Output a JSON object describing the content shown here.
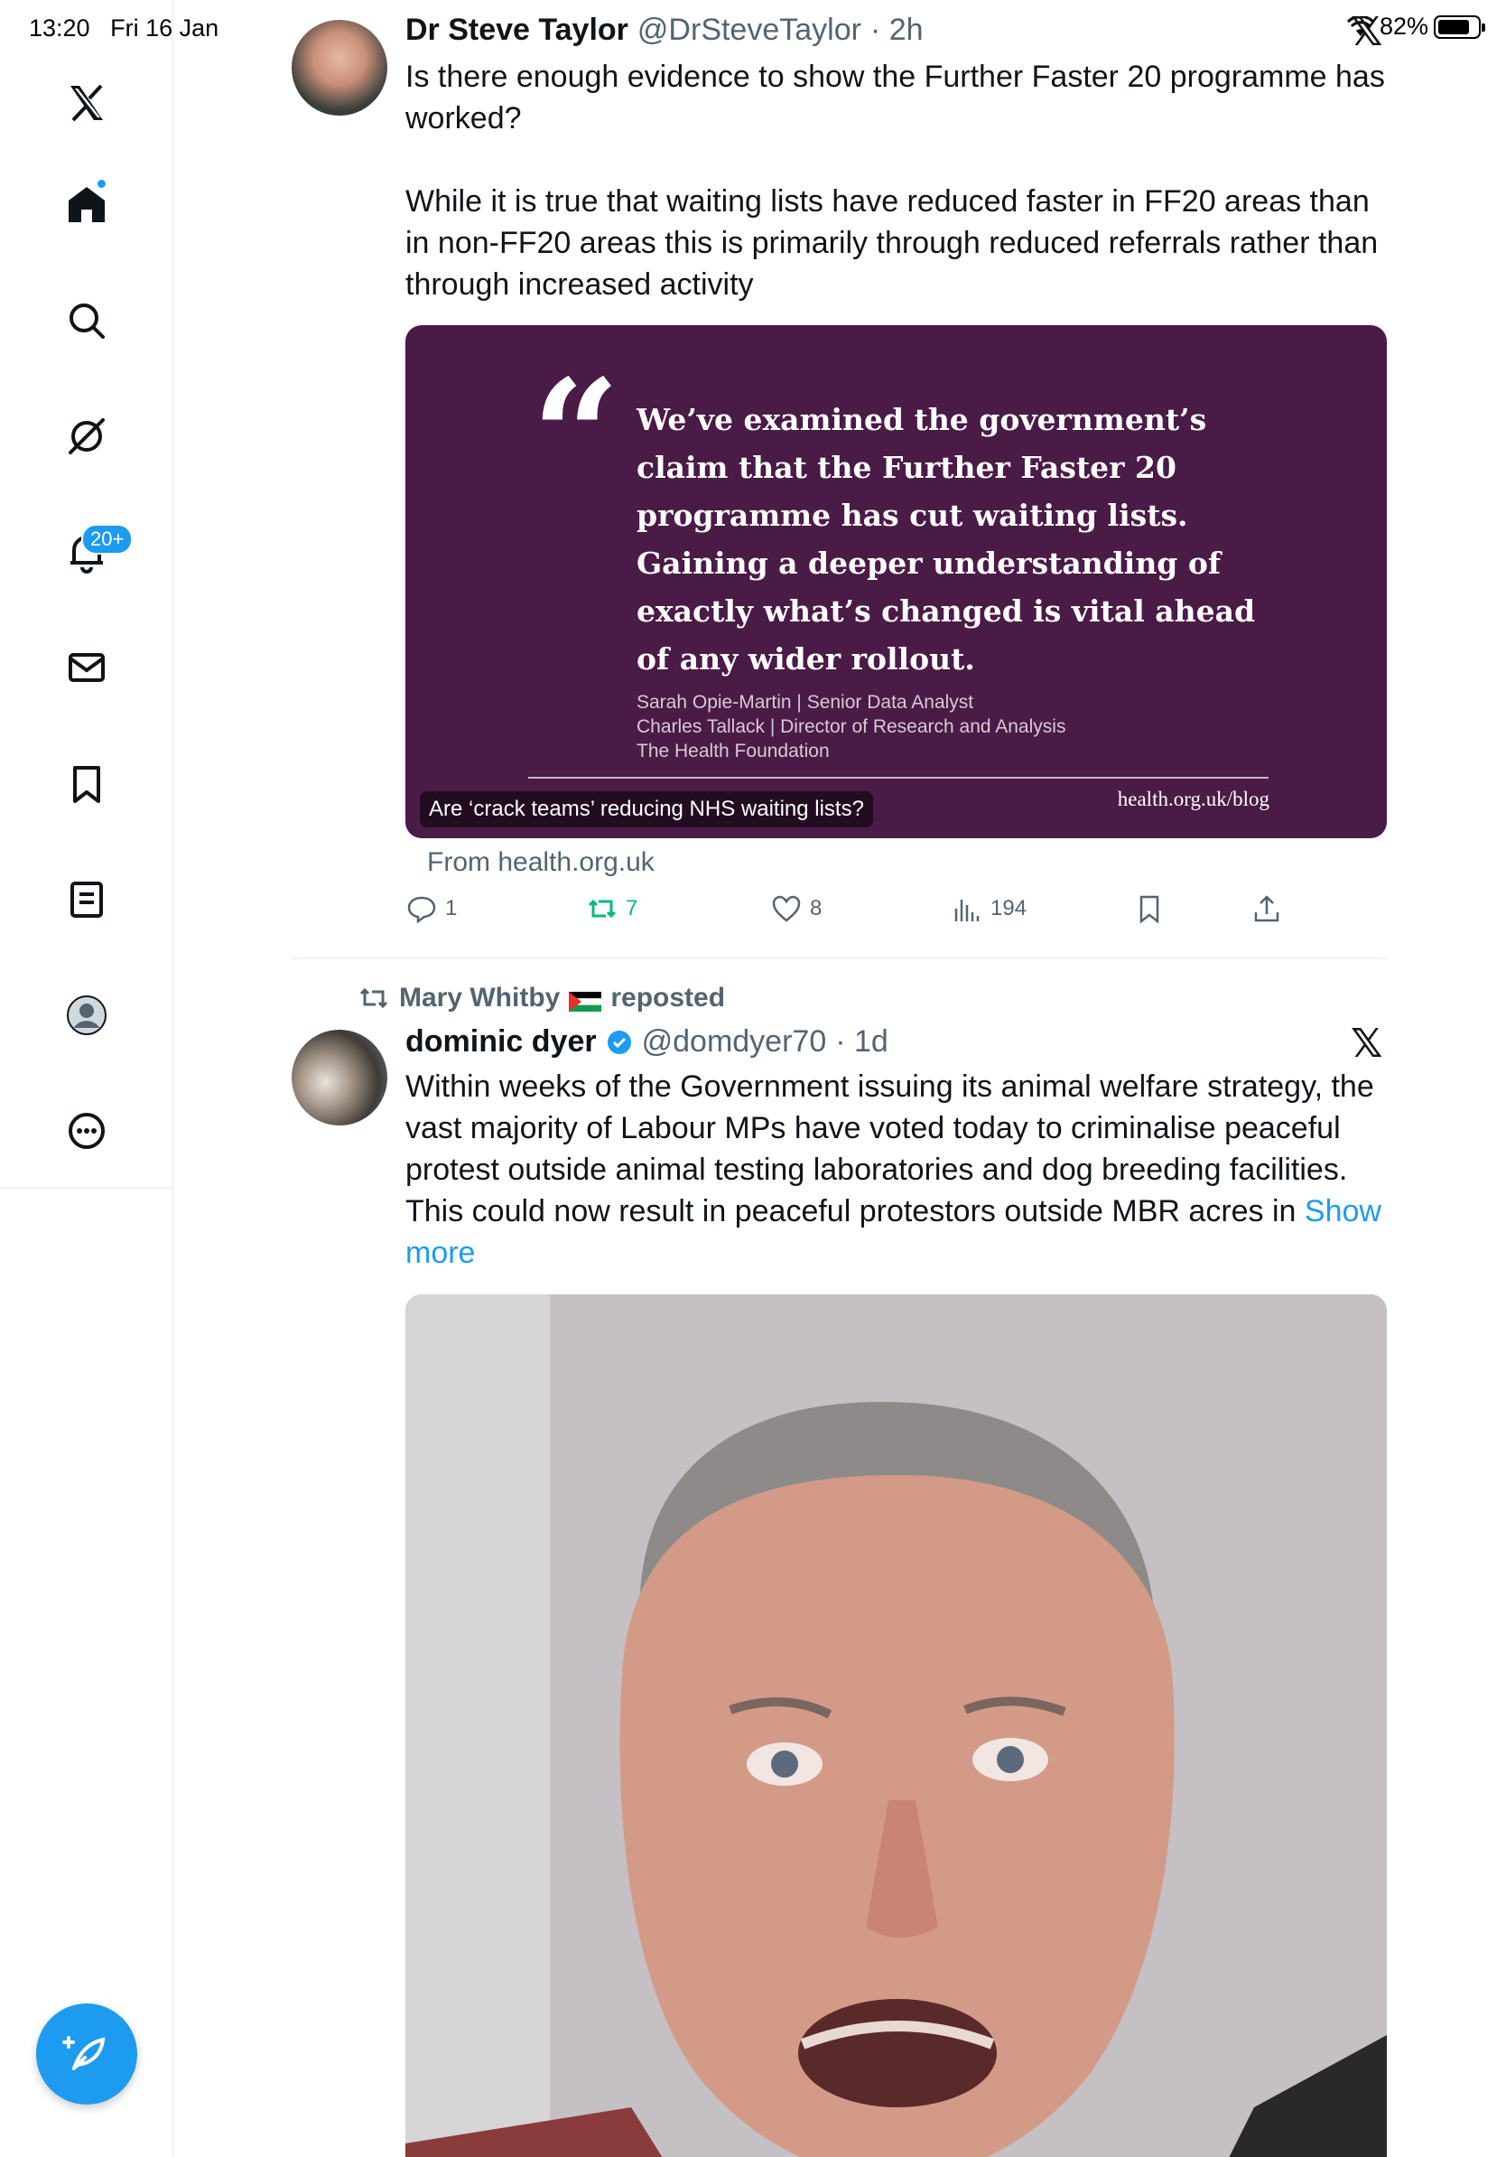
{
  "status_bar": {
    "time": "13:20",
    "date": "Fri 16 Jan",
    "battery": "82%",
    "battery_level": 0.82
  },
  "sidebar": {
    "notifications_badge": "20+",
    "items": [
      {
        "name": "x-logo-icon"
      },
      {
        "name": "home-icon"
      },
      {
        "name": "search-icon"
      },
      {
        "name": "grok-icon"
      },
      {
        "name": "bell-icon"
      },
      {
        "name": "mail-icon"
      },
      {
        "name": "bookmark-icon"
      },
      {
        "name": "lists-icon"
      },
      {
        "name": "profile-icon"
      },
      {
        "name": "more-icon"
      }
    ]
  },
  "tweet1": {
    "name": "Dr Steve Taylor",
    "handle": "@DrSteveTaylor",
    "time": "· 2h",
    "text": "Is there enough evidence to show the Further Faster 20 programme has worked?\n\nWhile it is true that waiting lists have reduced faster in FF20 areas than in non-FF20 areas this is primarily through reduced referrals rather than through increased activity",
    "card": {
      "quote": "We’ve examined the government’s claim that the Further Faster 20 programme has cut waiting lists. Gaining a deeper understanding of exactly what’s changed is vital ahead of any wider rollout.",
      "attribution1": "Sarah Opie-Martin | Senior Data Analyst",
      "attribution2": "Charles Tallack | Director of Research and Analysis",
      "attribution3": "The Health Foundation",
      "url": "health.org.uk/blog",
      "label": "Are ‘crack teams’ reducing NHS waiting lists?"
    },
    "from": "From health.org.uk",
    "actions": {
      "replies": "1",
      "reposts": "7",
      "likes": "8",
      "views": "194"
    }
  },
  "tweet2": {
    "reposted_by": "Mary Whitby",
    "reposted_label": "reposted",
    "name": "dominic dyer",
    "handle": "@domdyer70",
    "time": "· 1d",
    "text": "Within weeks of the Government issuing its animal welfare strategy, the vast majority of Labour MPs have voted today to criminalise peaceful protest outside animal testing laboratories and dog breeding facilities. This could now result in peaceful protestors outside MBR acres in ",
    "show_more": "Show more"
  },
  "colors": {
    "accent": "#1d9bf0",
    "card_bg": "#4a1b47",
    "repost_green": "#00ba7c",
    "muted": "#536471"
  }
}
